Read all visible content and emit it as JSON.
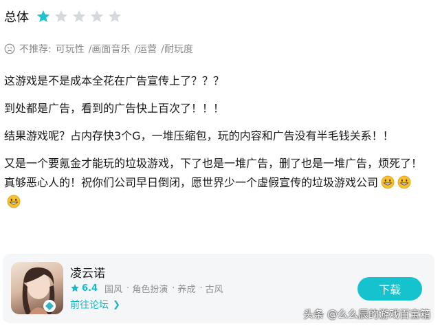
{
  "rating": {
    "label": "总体",
    "score": 1,
    "max": 5,
    "filled_color": "#1fc3cf",
    "empty_color": "#d6d9de"
  },
  "tags": {
    "icon": "sad-face-icon",
    "prefix": "不推荐:",
    "items": [
      "可玩性",
      "/画面音乐",
      "/运营",
      "/耐玩度"
    ]
  },
  "review": {
    "paragraphs": [
      "这游戏是不是成本全花在广告宣传上了？？？",
      "到处都是广告，看到的广告快上百次了！！！",
      "结果游戏呢？占内存快3个G，一堆压缩包，玩的内容和广告没有半毛钱关系！！",
      "又是一个要氪金才能玩的垃圾游戏，下了也是一堆广告，删了也是一堆广告，烦死了！真够恶心人的！祝你们公司早日倒闭，愿世界少一个虚假宣传的垃圾游戏公司"
    ],
    "trailing_emojis": [
      "grin-emoji",
      "grin-emoji",
      "grin-emoji"
    ]
  },
  "game": {
    "name": "凌云诺",
    "score": "6.4",
    "tags": [
      "国风",
      "角色扮演",
      "养成",
      "古风"
    ],
    "forum_link": "前往论坛",
    "download_label": "下载",
    "accent": "#15c3cf"
  },
  "watermark": "头条 @么么辰的游戏百宝箱"
}
